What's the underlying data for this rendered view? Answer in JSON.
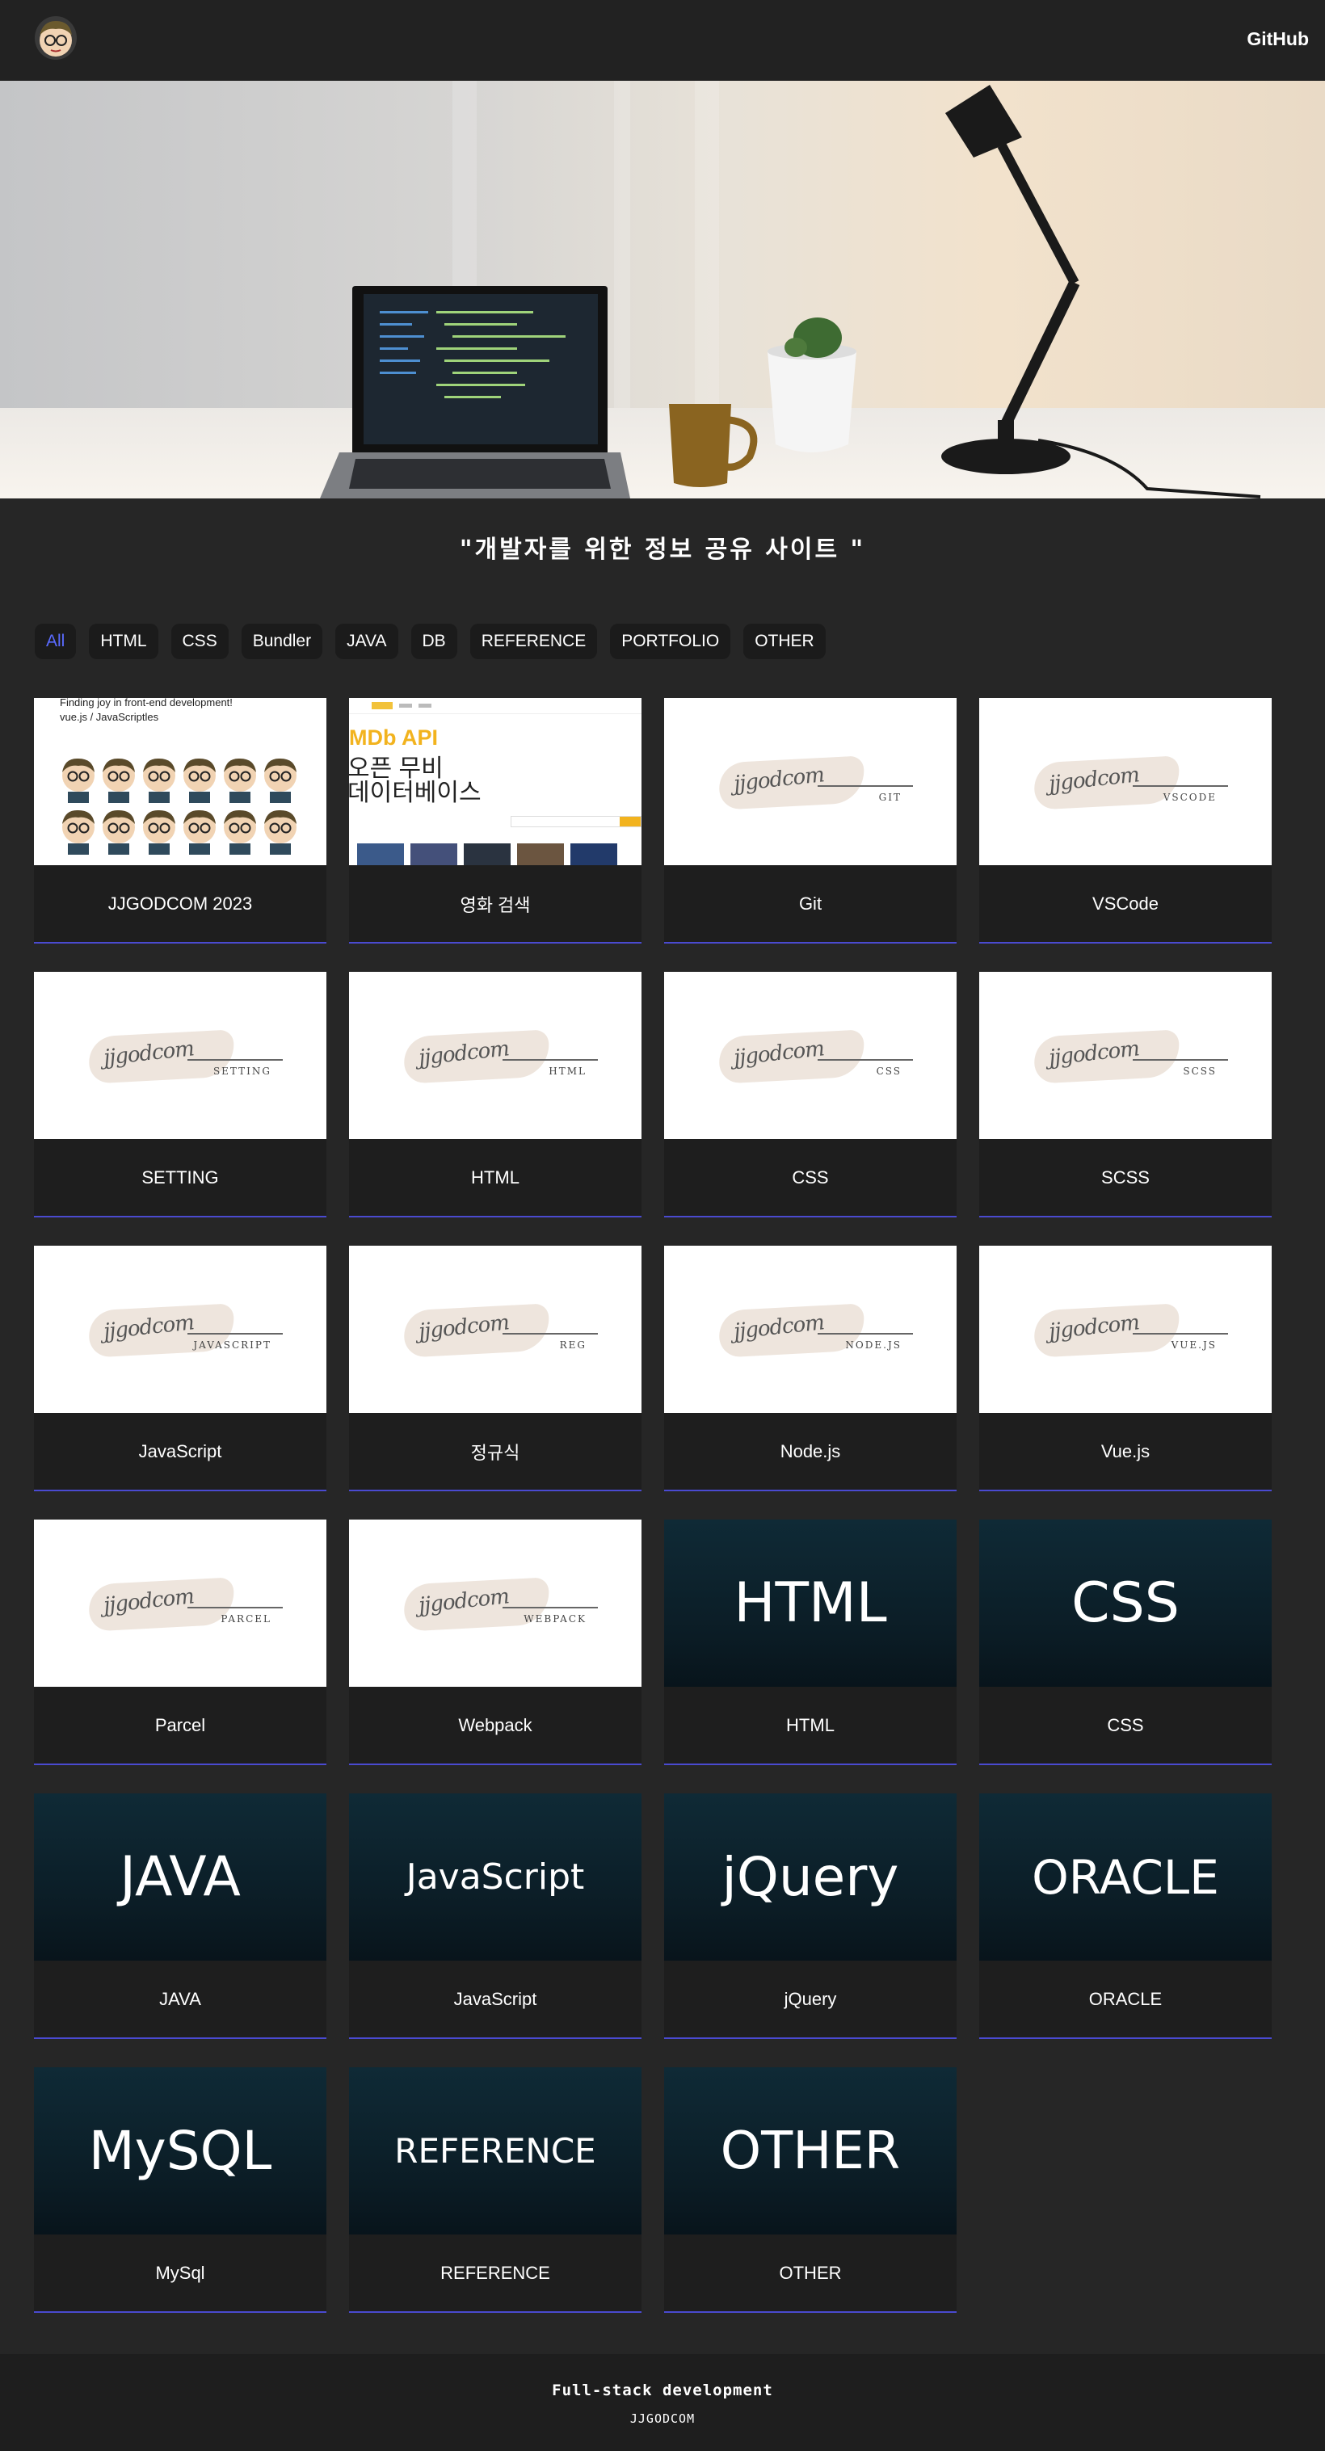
{
  "header": {
    "github_label": "GitHub"
  },
  "tagline": "\"개발자를 위한 정보 공유 사이트 \"",
  "filters": [
    "All",
    "HTML",
    "CSS",
    "Bundler",
    "JAVA",
    "DB",
    "REFERENCE",
    "PORTFOLIO",
    "OTHER"
  ],
  "active_filter": "All",
  "thumb_text": {
    "jjgod_line1": "Finding joy in front-end development!",
    "jjgod_line2": "vue.js / JavaScriptles",
    "movie_api": "MDb API",
    "movie_l1": "오픈 무비",
    "movie_l2": "데이터베이스",
    "signature": "jjgodcom"
  },
  "cards": [
    {
      "title": "JJGODCOM 2023"
    },
    {
      "title": "영화 검색"
    },
    {
      "title": "Git",
      "sig": "GIT"
    },
    {
      "title": "VSCode",
      "sig": "VSCODE"
    },
    {
      "title": "SETTING",
      "sig": "SETTING"
    },
    {
      "title": "HTML",
      "sig": "HTML"
    },
    {
      "title": "CSS",
      "sig": "CSS"
    },
    {
      "title": "SCSS",
      "sig": "SCSS"
    },
    {
      "title": "JavaScript",
      "sig": "JAVASCRIPT"
    },
    {
      "title": "정규식",
      "sig": "REG"
    },
    {
      "title": "Node.js",
      "sig": "NODE.JS"
    },
    {
      "title": "Vue.js",
      "sig": "VUE.JS"
    },
    {
      "title": "Parcel",
      "sig": "PARCEL"
    },
    {
      "title": "Webpack",
      "sig": "WEBPACK"
    },
    {
      "title": "HTML",
      "big": "HTML"
    },
    {
      "title": "CSS",
      "big": "CSS"
    },
    {
      "title": "JAVA",
      "big": "JAVA"
    },
    {
      "title": "JavaScript",
      "big": "JavaScript"
    },
    {
      "title": "jQuery",
      "big": "jQuery"
    },
    {
      "title": "ORACLE",
      "big": "ORACLE"
    },
    {
      "title": "MySql",
      "big": "MySQL"
    },
    {
      "title": "REFERENCE",
      "big": "REFERENCE"
    },
    {
      "title": "OTHER",
      "big": "OTHER"
    }
  ],
  "footer": {
    "line1": "Full-stack development",
    "line2": "JJGODCOM"
  },
  "colors": {
    "accent": "#4a4ad0",
    "active_chip": "#5a6bff",
    "bg": "#262626"
  }
}
